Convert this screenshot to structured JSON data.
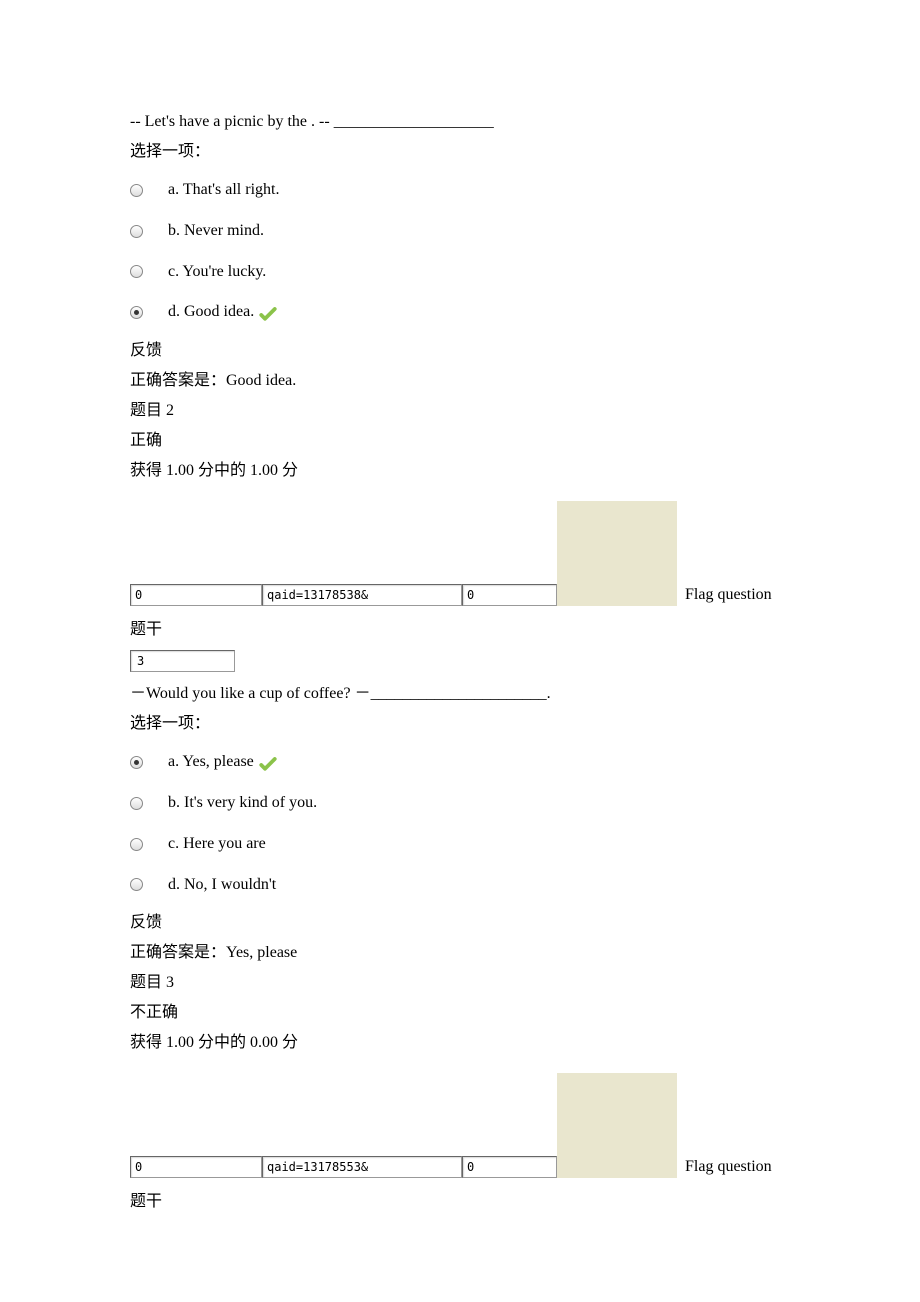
{
  "q1": {
    "question": "-- Let's have a picnic by the . -- ____________________",
    "prompt": "选择一项：",
    "options": {
      "a": "a. That's all right.",
      "b": "b. Never mind.",
      "c": "c. You're lucky.",
      "d": "d. Good idea."
    },
    "feedback_label": "反馈",
    "correct_answer": "正确答案是：Good idea.",
    "next_title": "题目 2",
    "next_status": "正确",
    "next_score": "获得 1.00 分中的 1.00 分"
  },
  "flag1": {
    "box1": "0",
    "box2": "qaid=13178538&",
    "box3": "0",
    "label": "Flag question"
  },
  "q2": {
    "stem_label": "题干",
    "stem_box": "3",
    "question": "－Would you like a cup of coffee?  －______________________.",
    "prompt": "选择一项：",
    "options": {
      "a": "a. Yes, please",
      "b": "b. It's very kind of you.",
      "c": "c. Here you are",
      "d": "d. No, I wouldn't"
    },
    "feedback_label": "反馈",
    "correct_answer": "正确答案是：Yes, please",
    "next_title": "题目 3",
    "next_status": "不正确",
    "next_score": "获得 1.00 分中的 0.00 分"
  },
  "flag2": {
    "box1": "0",
    "box2": "qaid=13178553&",
    "box3": "0",
    "label": "Flag question"
  },
  "q3": {
    "stem_label": "题干"
  }
}
